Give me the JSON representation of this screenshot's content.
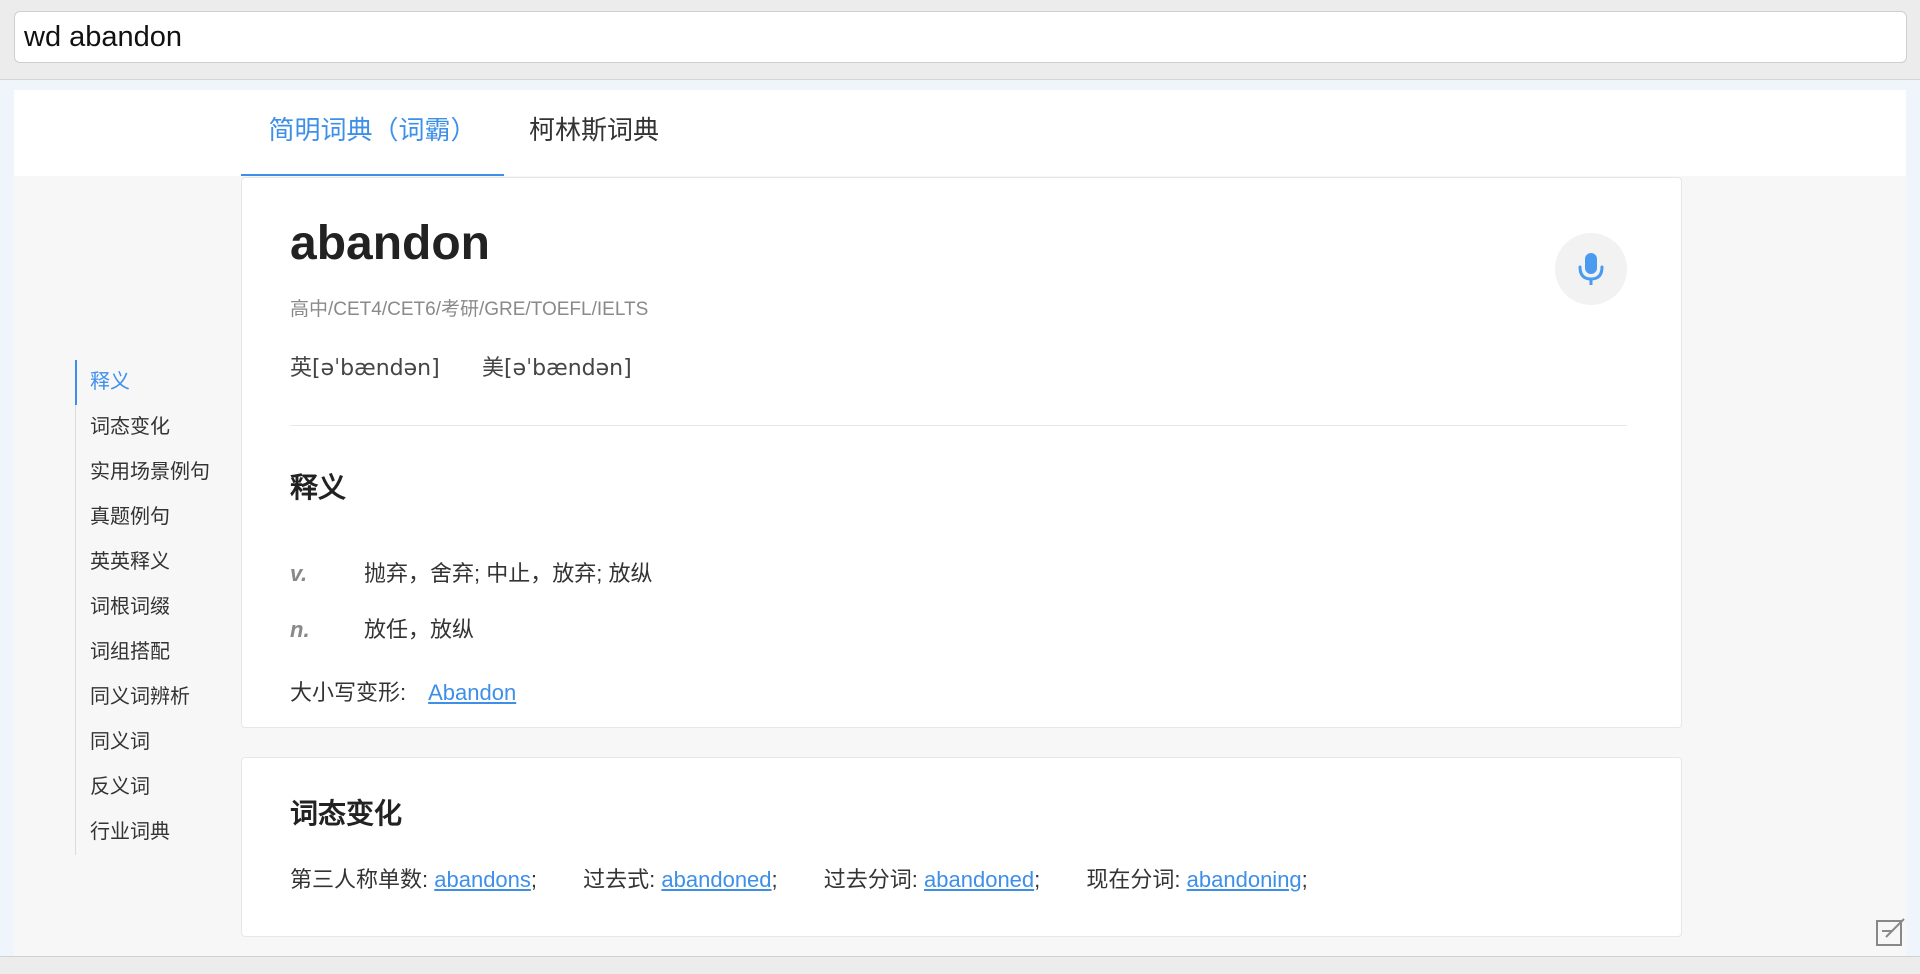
{
  "search": {
    "value": "wd abandon"
  },
  "tabs": [
    {
      "label": "简明词典（词霸）",
      "active": true
    },
    {
      "label": "柯林斯词典",
      "active": false
    }
  ],
  "sidenav": {
    "items": [
      {
        "label": "释义",
        "active": true
      },
      {
        "label": "词态变化"
      },
      {
        "label": "实用场景例句"
      },
      {
        "label": "真题例句"
      },
      {
        "label": "英英释义"
      },
      {
        "label": "词根词缀"
      },
      {
        "label": "词组搭配"
      },
      {
        "label": "同义词辨析"
      },
      {
        "label": "同义词"
      },
      {
        "label": "反义词"
      },
      {
        "label": "行业词典"
      }
    ]
  },
  "entry": {
    "word": "abandon",
    "tags": "高中/CET4/CET6/考研/GRE/TOEFL/IELTS",
    "phonetic_uk": "英[əˈbændən]",
    "phonetic_us": "美[əˈbændən]",
    "mic_icon": "microphone-icon"
  },
  "definitions": {
    "title": "释义",
    "items": [
      {
        "pos": "v.",
        "meaning": "抛弃，舍弃; 中止，放弃; 放纵"
      },
      {
        "pos": "n.",
        "meaning": "放任，放纵"
      }
    ],
    "variant_label": "大小写变形:",
    "variant_link": "Abandon"
  },
  "forms": {
    "title": "词态变化",
    "items": [
      {
        "label": "第三人称单数:",
        "value": "abandons",
        "suffix": ";"
      },
      {
        "label": "过去式:",
        "value": "abandoned",
        "suffix": ";"
      },
      {
        "label": "过去分词:",
        "value": "abandoned",
        "suffix": ";"
      },
      {
        "label": "现在分词:",
        "value": "abandoning",
        "suffix": ";"
      }
    ]
  },
  "colors": {
    "accent": "#3d8fe8",
    "text": "#333333",
    "muted": "#8a8a8a"
  }
}
